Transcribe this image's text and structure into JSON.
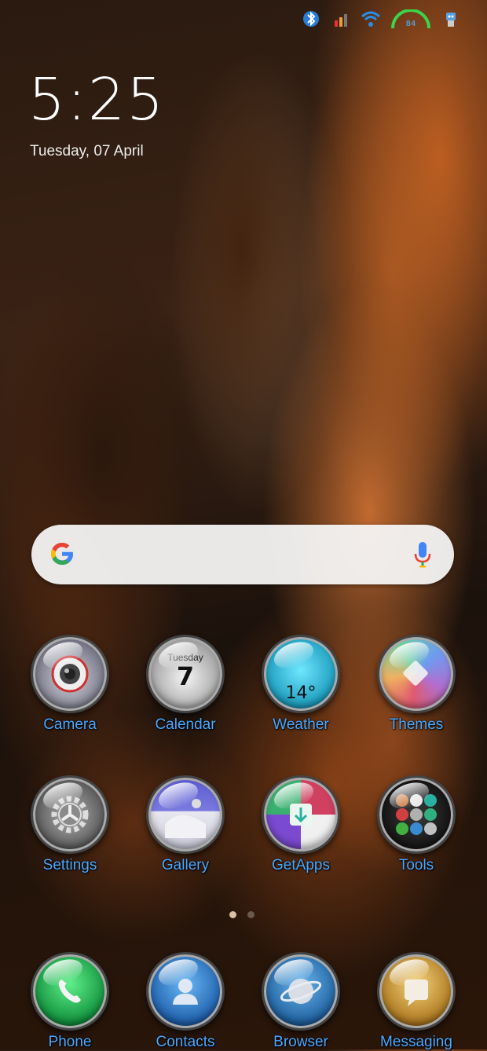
{
  "status_bar": {
    "icons": [
      "bluetooth-icon",
      "signal-icon",
      "wifi-icon",
      "battery-gauge-icon",
      "robot-icon"
    ],
    "battery_text": "84"
  },
  "lockscreen": {
    "time": "5:25",
    "date": "Tuesday, 07 April"
  },
  "search_bar": {
    "logo": "google-g-icon",
    "mic": "microphone-icon"
  },
  "apps": [
    {
      "label": "Camera",
      "icon": "camera-icon",
      "color": "#b8b8c4"
    },
    {
      "label": "Calendar",
      "icon": "calendar-icon",
      "color": "#d9d9d9",
      "day_name": "Tuesday",
      "day_number": "7"
    },
    {
      "label": "Weather",
      "icon": "weather-icon",
      "color": "#22b8d8",
      "temp": "14°"
    },
    {
      "label": "Themes",
      "icon": "themes-icon",
      "color": "#8d6fb0"
    },
    {
      "label": "Settings",
      "icon": "gear-icon",
      "color": "#8d8d8d"
    },
    {
      "label": "Gallery",
      "icon": "gallery-icon",
      "color": "#6f6fb8"
    },
    {
      "label": "GetApps",
      "icon": "getapps-icon",
      "color": "#3aa06a"
    },
    {
      "label": "Tools",
      "icon": "tools-folder-icon",
      "color": "#2a2a2a"
    }
  ],
  "dock": [
    {
      "label": "Phone",
      "icon": "phone-icon",
      "color": "#1aa64a"
    },
    {
      "label": "Contacts",
      "icon": "contacts-icon",
      "color": "#2580d0"
    },
    {
      "label": "Browser",
      "icon": "browser-icon",
      "color": "#2b7fc0"
    },
    {
      "label": "Messaging",
      "icon": "messaging-icon",
      "color": "#d6a23a"
    }
  ],
  "page_indicator": {
    "pages": 2,
    "current": 1
  }
}
